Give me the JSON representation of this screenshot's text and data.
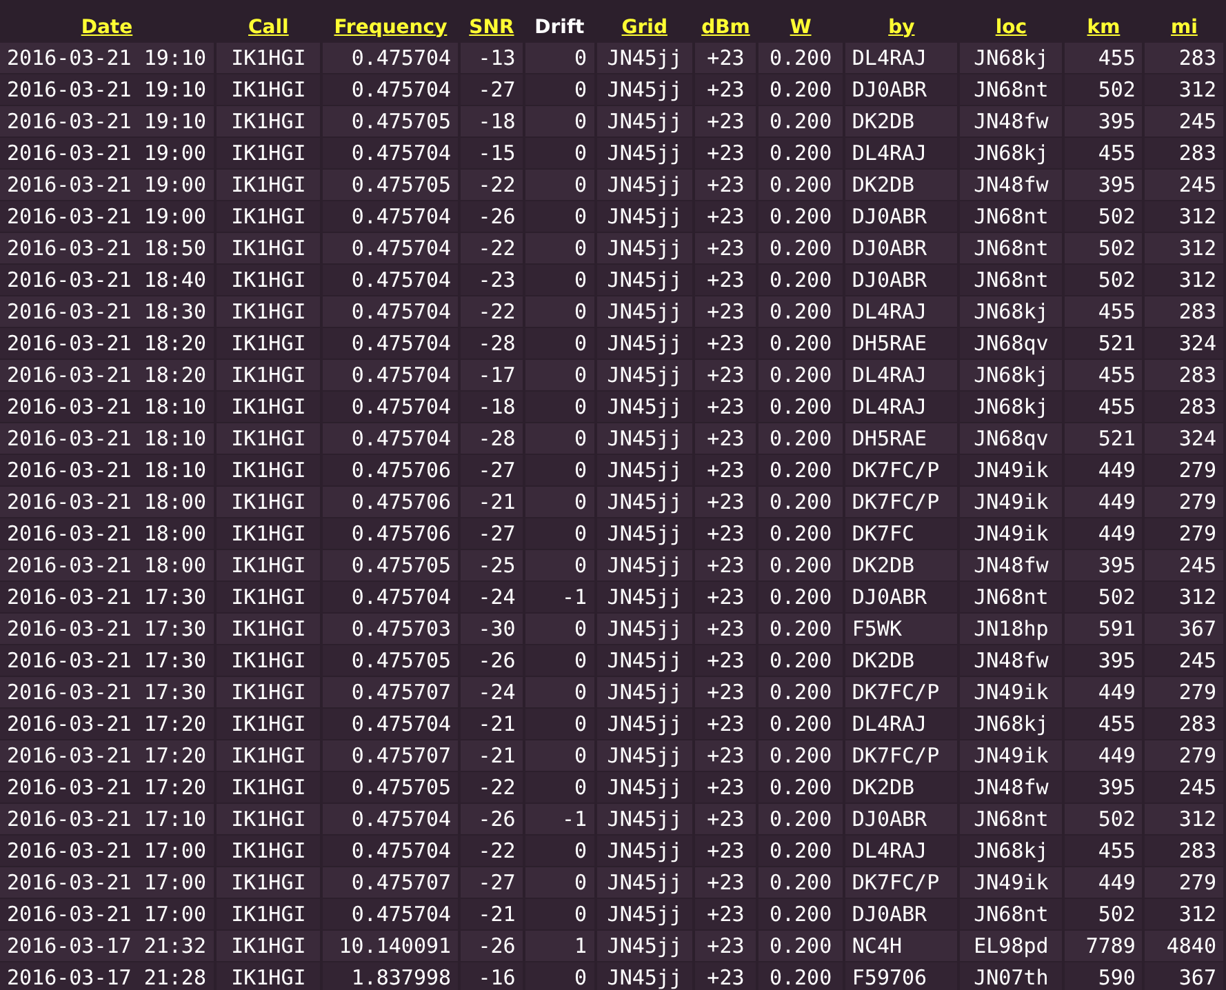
{
  "table": {
    "columns": [
      {
        "label": "Date",
        "kind": "link"
      },
      {
        "label": "Call",
        "kind": "link"
      },
      {
        "label": "Frequency",
        "kind": "link"
      },
      {
        "label": "SNR",
        "kind": "link"
      },
      {
        "label": "Drift",
        "kind": "plain"
      },
      {
        "label": "Grid",
        "kind": "link"
      },
      {
        "label": "dBm",
        "kind": "link"
      },
      {
        "label": "W",
        "kind": "link"
      },
      {
        "label": "by",
        "kind": "link"
      },
      {
        "label": "loc",
        "kind": "link"
      },
      {
        "label": "km",
        "kind": "link"
      },
      {
        "label": "mi",
        "kind": "link"
      }
    ],
    "rows": [
      [
        "2016-03-21 19:10",
        "IK1HGI",
        "0.475704",
        "-13",
        "0",
        "JN45jj",
        "+23",
        "0.200",
        "DL4RAJ",
        "JN68kj",
        "455",
        "283"
      ],
      [
        "2016-03-21 19:10",
        "IK1HGI",
        "0.475704",
        "-27",
        "0",
        "JN45jj",
        "+23",
        "0.200",
        "DJ0ABR",
        "JN68nt",
        "502",
        "312"
      ],
      [
        "2016-03-21 19:10",
        "IK1HGI",
        "0.475705",
        "-18",
        "0",
        "JN45jj",
        "+23",
        "0.200",
        "DK2DB",
        "JN48fw",
        "395",
        "245"
      ],
      [
        "2016-03-21 19:00",
        "IK1HGI",
        "0.475704",
        "-15",
        "0",
        "JN45jj",
        "+23",
        "0.200",
        "DL4RAJ",
        "JN68kj",
        "455",
        "283"
      ],
      [
        "2016-03-21 19:00",
        "IK1HGI",
        "0.475705",
        "-22",
        "0",
        "JN45jj",
        "+23",
        "0.200",
        "DK2DB",
        "JN48fw",
        "395",
        "245"
      ],
      [
        "2016-03-21 19:00",
        "IK1HGI",
        "0.475704",
        "-26",
        "0",
        "JN45jj",
        "+23",
        "0.200",
        "DJ0ABR",
        "JN68nt",
        "502",
        "312"
      ],
      [
        "2016-03-21 18:50",
        "IK1HGI",
        "0.475704",
        "-22",
        "0",
        "JN45jj",
        "+23",
        "0.200",
        "DJ0ABR",
        "JN68nt",
        "502",
        "312"
      ],
      [
        "2016-03-21 18:40",
        "IK1HGI",
        "0.475704",
        "-23",
        "0",
        "JN45jj",
        "+23",
        "0.200",
        "DJ0ABR",
        "JN68nt",
        "502",
        "312"
      ],
      [
        "2016-03-21 18:30",
        "IK1HGI",
        "0.475704",
        "-22",
        "0",
        "JN45jj",
        "+23",
        "0.200",
        "DL4RAJ",
        "JN68kj",
        "455",
        "283"
      ],
      [
        "2016-03-21 18:20",
        "IK1HGI",
        "0.475704",
        "-28",
        "0",
        "JN45jj",
        "+23",
        "0.200",
        "DH5RAE",
        "JN68qv",
        "521",
        "324"
      ],
      [
        "2016-03-21 18:20",
        "IK1HGI",
        "0.475704",
        "-17",
        "0",
        "JN45jj",
        "+23",
        "0.200",
        "DL4RAJ",
        "JN68kj",
        "455",
        "283"
      ],
      [
        "2016-03-21 18:10",
        "IK1HGI",
        "0.475704",
        "-18",
        "0",
        "JN45jj",
        "+23",
        "0.200",
        "DL4RAJ",
        "JN68kj",
        "455",
        "283"
      ],
      [
        "2016-03-21 18:10",
        "IK1HGI",
        "0.475704",
        "-28",
        "0",
        "JN45jj",
        "+23",
        "0.200",
        "DH5RAE",
        "JN68qv",
        "521",
        "324"
      ],
      [
        "2016-03-21 18:10",
        "IK1HGI",
        "0.475706",
        "-27",
        "0",
        "JN45jj",
        "+23",
        "0.200",
        "DK7FC/P",
        "JN49ik",
        "449",
        "279"
      ],
      [
        "2016-03-21 18:00",
        "IK1HGI",
        "0.475706",
        "-21",
        "0",
        "JN45jj",
        "+23",
        "0.200",
        "DK7FC/P",
        "JN49ik",
        "449",
        "279"
      ],
      [
        "2016-03-21 18:00",
        "IK1HGI",
        "0.475706",
        "-27",
        "0",
        "JN45jj",
        "+23",
        "0.200",
        "DK7FC",
        "JN49ik",
        "449",
        "279"
      ],
      [
        "2016-03-21 18:00",
        "IK1HGI",
        "0.475705",
        "-25",
        "0",
        "JN45jj",
        "+23",
        "0.200",
        "DK2DB",
        "JN48fw",
        "395",
        "245"
      ],
      [
        "2016-03-21 17:30",
        "IK1HGI",
        "0.475704",
        "-24",
        "-1",
        "JN45jj",
        "+23",
        "0.200",
        "DJ0ABR",
        "JN68nt",
        "502",
        "312"
      ],
      [
        "2016-03-21 17:30",
        "IK1HGI",
        "0.475703",
        "-30",
        "0",
        "JN45jj",
        "+23",
        "0.200",
        "F5WK",
        "JN18hp",
        "591",
        "367"
      ],
      [
        "2016-03-21 17:30",
        "IK1HGI",
        "0.475705",
        "-26",
        "0",
        "JN45jj",
        "+23",
        "0.200",
        "DK2DB",
        "JN48fw",
        "395",
        "245"
      ],
      [
        "2016-03-21 17:30",
        "IK1HGI",
        "0.475707",
        "-24",
        "0",
        "JN45jj",
        "+23",
        "0.200",
        "DK7FC/P",
        "JN49ik",
        "449",
        "279"
      ],
      [
        "2016-03-21 17:20",
        "IK1HGI",
        "0.475704",
        "-21",
        "0",
        "JN45jj",
        "+23",
        "0.200",
        "DL4RAJ",
        "JN68kj",
        "455",
        "283"
      ],
      [
        "2016-03-21 17:20",
        "IK1HGI",
        "0.475707",
        "-21",
        "0",
        "JN45jj",
        "+23",
        "0.200",
        "DK7FC/P",
        "JN49ik",
        "449",
        "279"
      ],
      [
        "2016-03-21 17:20",
        "IK1HGI",
        "0.475705",
        "-22",
        "0",
        "JN45jj",
        "+23",
        "0.200",
        "DK2DB",
        "JN48fw",
        "395",
        "245"
      ],
      [
        "2016-03-21 17:10",
        "IK1HGI",
        "0.475704",
        "-26",
        "-1",
        "JN45jj",
        "+23",
        "0.200",
        "DJ0ABR",
        "JN68nt",
        "502",
        "312"
      ],
      [
        "2016-03-21 17:00",
        "IK1HGI",
        "0.475704",
        "-22",
        "0",
        "JN45jj",
        "+23",
        "0.200",
        "DL4RAJ",
        "JN68kj",
        "455",
        "283"
      ],
      [
        "2016-03-21 17:00",
        "IK1HGI",
        "0.475707",
        "-27",
        "0",
        "JN45jj",
        "+23",
        "0.200",
        "DK7FC/P",
        "JN49ik",
        "449",
        "279"
      ],
      [
        "2016-03-21 17:00",
        "IK1HGI",
        "0.475704",
        "-21",
        "0",
        "JN45jj",
        "+23",
        "0.200",
        "DJ0ABR",
        "JN68nt",
        "502",
        "312"
      ],
      [
        "2016-03-17 21:32",
        "IK1HGI",
        "10.140091",
        "-26",
        "1",
        "JN45jj",
        "+23",
        "0.200",
        "NC4H",
        "EL98pd",
        "7789",
        "4840"
      ],
      [
        "2016-03-17 21:28",
        "IK1HGI",
        "1.837998",
        "-16",
        "0",
        "JN45jj",
        "+23",
        "0.200",
        "F59706",
        "JN07th",
        "590",
        "367"
      ]
    ]
  }
}
